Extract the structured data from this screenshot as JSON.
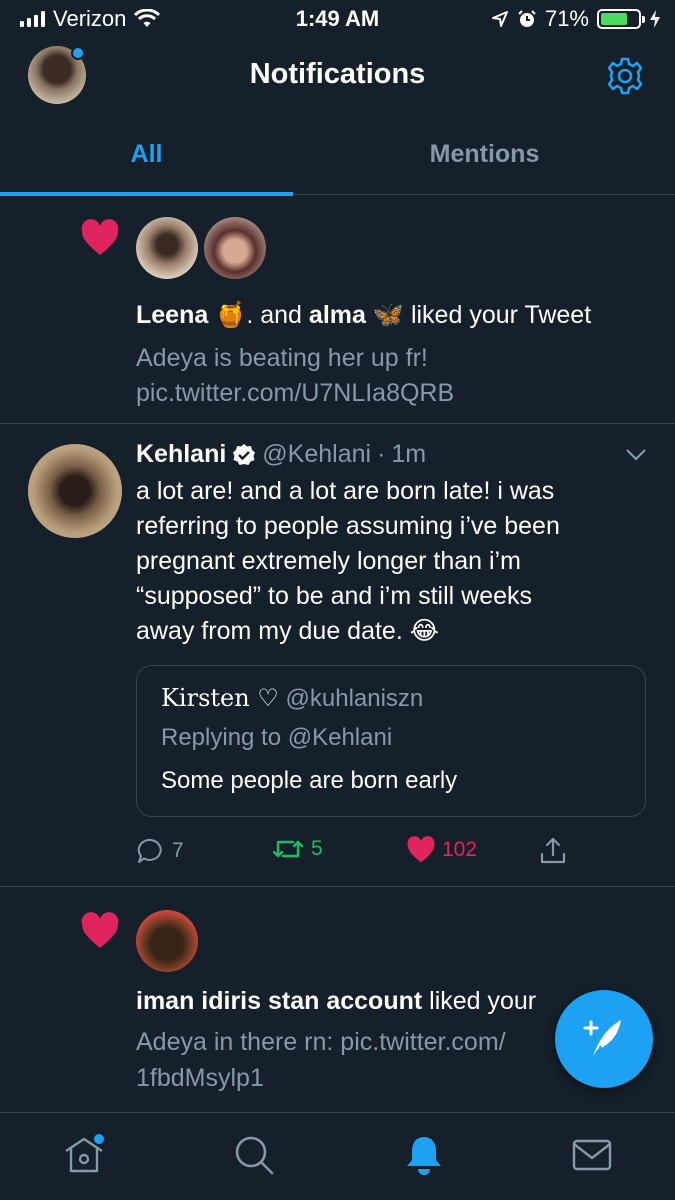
{
  "status_bar": {
    "carrier": "Verizon",
    "time": "1:49 AM",
    "battery": "71%",
    "battery_level": 0.71
  },
  "header": {
    "title": "Notifications"
  },
  "tabs": [
    {
      "label": "All",
      "active": true
    },
    {
      "label": "Mentions",
      "active": false
    }
  ],
  "notification1": {
    "user1": "Leena",
    "user1_emoji": "🍯",
    "joiner": ". and ",
    "user2": "alma",
    "user2_emoji": "🦋",
    "action": "liked your Tweet",
    "tweet_line1": "Adeya is beating her up fr!",
    "tweet_line2": "pic.twitter.com/U7NLIa8QRB"
  },
  "tweet": {
    "name": "Kehlani",
    "handle": "@Kehlani",
    "sep": "·",
    "time": "1m",
    "lines": [
      "a lot are! and a lot are born late! i was",
      "referring to people assuming i’ve been",
      "pregnant extremely longer than i’m",
      "“supposed” to be and i’m still weeks",
      "away from my due date. 😂"
    ],
    "quote": {
      "name": "Kirsten ♡",
      "handle": "@kuhlaniszn",
      "replying_to": "Replying to @Kehlani",
      "text": "Some people are born early"
    },
    "replies": "7",
    "retweets": "5",
    "likes": "102"
  },
  "notification2": {
    "user": "iman idiris stan account",
    "action": " liked your",
    "tweet_line1": "Adeya in there rn: pic.twitter.com/",
    "tweet_line2": "1fbdMsylp1"
  },
  "colors": {
    "accent": "#1da1f2",
    "background": "#15202b",
    "muted": "#8899a6",
    "like": "#e0245e",
    "retweet": "#17bf63",
    "border": "#38444d"
  },
  "icons": [
    "home-icon",
    "search-icon",
    "bell-icon",
    "mail-icon",
    "settings-icon",
    "heart-icon",
    "reply-icon",
    "retweet-icon",
    "share-icon",
    "compose-icon"
  ]
}
